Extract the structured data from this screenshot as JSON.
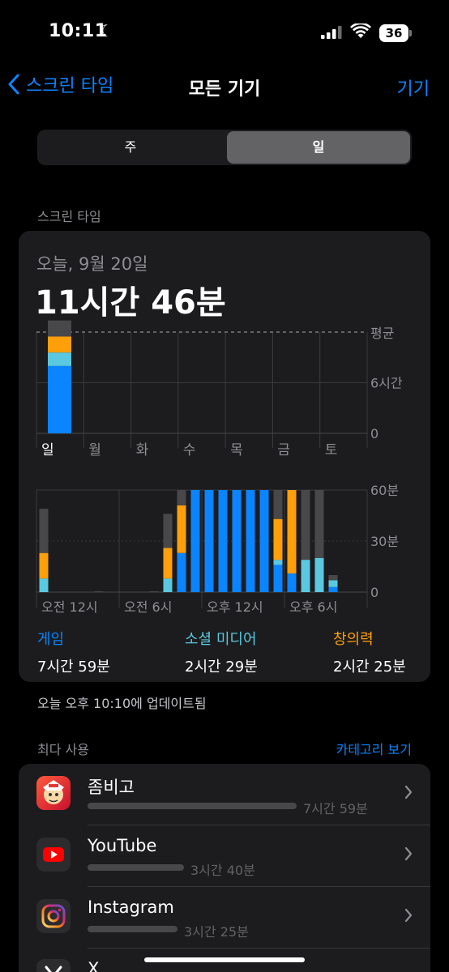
{
  "status_bar": {
    "time": "10:11",
    "battery": "36"
  },
  "nav": {
    "back_label": "스크린 타임",
    "title": "모든 기기",
    "right_label": "기기"
  },
  "segment": {
    "options": [
      "주",
      "일"
    ],
    "selected": "일"
  },
  "section_label": "스크린 타임",
  "summary": {
    "date": "오늘, 9월 20일",
    "total": "11시간 46분"
  },
  "colors": {
    "game": "#0a84ff",
    "social": "#5ac8e0",
    "creativity": "#ff9f0a",
    "other": "#48484a",
    "accent": "#0a84ff"
  },
  "chart_data": [
    {
      "type": "bar",
      "stacked": true,
      "categories": [
        "일",
        "월",
        "화",
        "수",
        "목",
        "금",
        "토"
      ],
      "y_ticks": [
        "0",
        "6시간"
      ],
      "average_label": "평균",
      "ylim_hours": [
        0,
        12
      ],
      "series": [
        {
          "name": "게임",
          "values": [
            7.98,
            0,
            0,
            0,
            0,
            0,
            0
          ]
        },
        {
          "name": "소셜 미디어",
          "values": [
            1.6,
            0,
            0,
            0,
            0,
            0,
            0
          ]
        },
        {
          "name": "창의력",
          "values": [
            1.9,
            0,
            0,
            0,
            0,
            0,
            0
          ]
        },
        {
          "name": "",
          "values": [
            1.9,
            0,
            0,
            0,
            0,
            0,
            0
          ]
        }
      ]
    },
    {
      "type": "bar",
      "stacked": true,
      "x_tick_labels": [
        "오전 12시",
        "오전 6시",
        "오후 12시",
        "오후 6시"
      ],
      "y_ticks": [
        "0",
        "30분",
        "60분"
      ],
      "ylim_minutes": [
        0,
        60
      ],
      "hours": [
        0,
        1,
        2,
        3,
        4,
        5,
        6,
        7,
        8,
        9,
        10,
        11,
        12,
        13,
        14,
        15,
        16,
        17,
        18,
        19,
        20,
        21,
        22,
        23
      ],
      "series": [
        {
          "name": "게임",
          "values": [
            0,
            0,
            0,
            0,
            0,
            0,
            0,
            0,
            0,
            0,
            0,
            0,
            0,
            0,
            0,
            0,
            0,
            0,
            0,
            0,
            0,
            0,
            0,
            0
          ]
        },
        {
          "name": "소셜 미디어",
          "values": [
            8,
            0,
            0,
            0,
            0,
            0,
            0,
            0,
            0,
            0,
            0,
            0,
            0,
            0,
            0,
            0,
            0,
            0,
            0,
            0,
            0,
            0,
            0,
            0
          ]
        },
        {
          "name": "창의력",
          "values": [
            15,
            0,
            0,
            0,
            0,
            0,
            0,
            0,
            0,
            0,
            0,
            0,
            0,
            0,
            0,
            0,
            0,
            0,
            0,
            0,
            0,
            0,
            0,
            0
          ]
        },
        {
          "name": "",
          "values": [
            26,
            0,
            0,
            0,
            0,
            0,
            0,
            0,
            0,
            0,
            0,
            0,
            0,
            0,
            0,
            0,
            0,
            0,
            0,
            0,
            0,
            0,
            0,
            0
          ]
        }
      ]
    }
  ],
  "hourly_bars": [
    {
      "h": 0,
      "game": 0,
      "social": 8,
      "creativity": 15,
      "other": 26
    },
    {
      "h": 4,
      "game": 0,
      "social": 0,
      "creativity": 0,
      "other": 0.5
    },
    {
      "h": 8,
      "game": 0,
      "social": 0,
      "creativity": 0,
      "other": 0.5
    },
    {
      "h": 9,
      "game": 0,
      "social": 8,
      "creativity": 18,
      "other": 20
    },
    {
      "h": 10,
      "game": 23,
      "social": 0,
      "creativity": 28,
      "other": 9
    },
    {
      "h": 11,
      "game": 60,
      "social": 0,
      "creativity": 0,
      "other": 0
    },
    {
      "h": 12,
      "game": 60,
      "social": 0,
      "creativity": 0,
      "other": 0
    },
    {
      "h": 13,
      "game": 60,
      "social": 0,
      "creativity": 0,
      "other": 0
    },
    {
      "h": 14,
      "game": 60,
      "social": 0,
      "creativity": 0,
      "other": 0
    },
    {
      "h": 15,
      "game": 60,
      "social": 0,
      "creativity": 0,
      "other": 0
    },
    {
      "h": 16,
      "game": 60,
      "social": 0,
      "creativity": 0,
      "other": 0
    },
    {
      "h": 17,
      "game": 16,
      "social": 3,
      "creativity": 24,
      "other": 17
    },
    {
      "h": 18,
      "game": 11,
      "social": 0,
      "creativity": 49,
      "other": 0
    },
    {
      "h": 19,
      "game": 0,
      "social": 19,
      "creativity": 0,
      "other": 41
    },
    {
      "h": 20,
      "game": 0,
      "social": 20,
      "creativity": 0,
      "other": 40
    },
    {
      "h": 21,
      "game": 3,
      "social": 4,
      "creativity": 0,
      "other": 3
    }
  ],
  "legend": [
    {
      "name": "게임",
      "value": "7시간 59분",
      "color": "#0a84ff"
    },
    {
      "name": "소셜 미디어",
      "value": "2시간 29분",
      "color": "#5ac8e0"
    },
    {
      "name": "창의력",
      "value": "2시간 25분",
      "color": "#ff9f0a"
    }
  ],
  "updated": "오늘 오후 10:10에 업데이트됨",
  "most_used": {
    "label": "최다 사용",
    "category_link": "카테고리 보기"
  },
  "apps": [
    {
      "name": "좀비고",
      "time": "7시간 59분",
      "share": 1.0,
      "icon": "zombie-game-icon"
    },
    {
      "name": "YouTube",
      "time": "3시간 40분",
      "share": 0.46,
      "icon": "youtube-icon"
    },
    {
      "name": "Instagram",
      "time": "3시간 25분",
      "share": 0.43,
      "icon": "instagram-icon"
    },
    {
      "name": "X",
      "time": "",
      "share": 0.2,
      "icon": "x-icon"
    }
  ]
}
